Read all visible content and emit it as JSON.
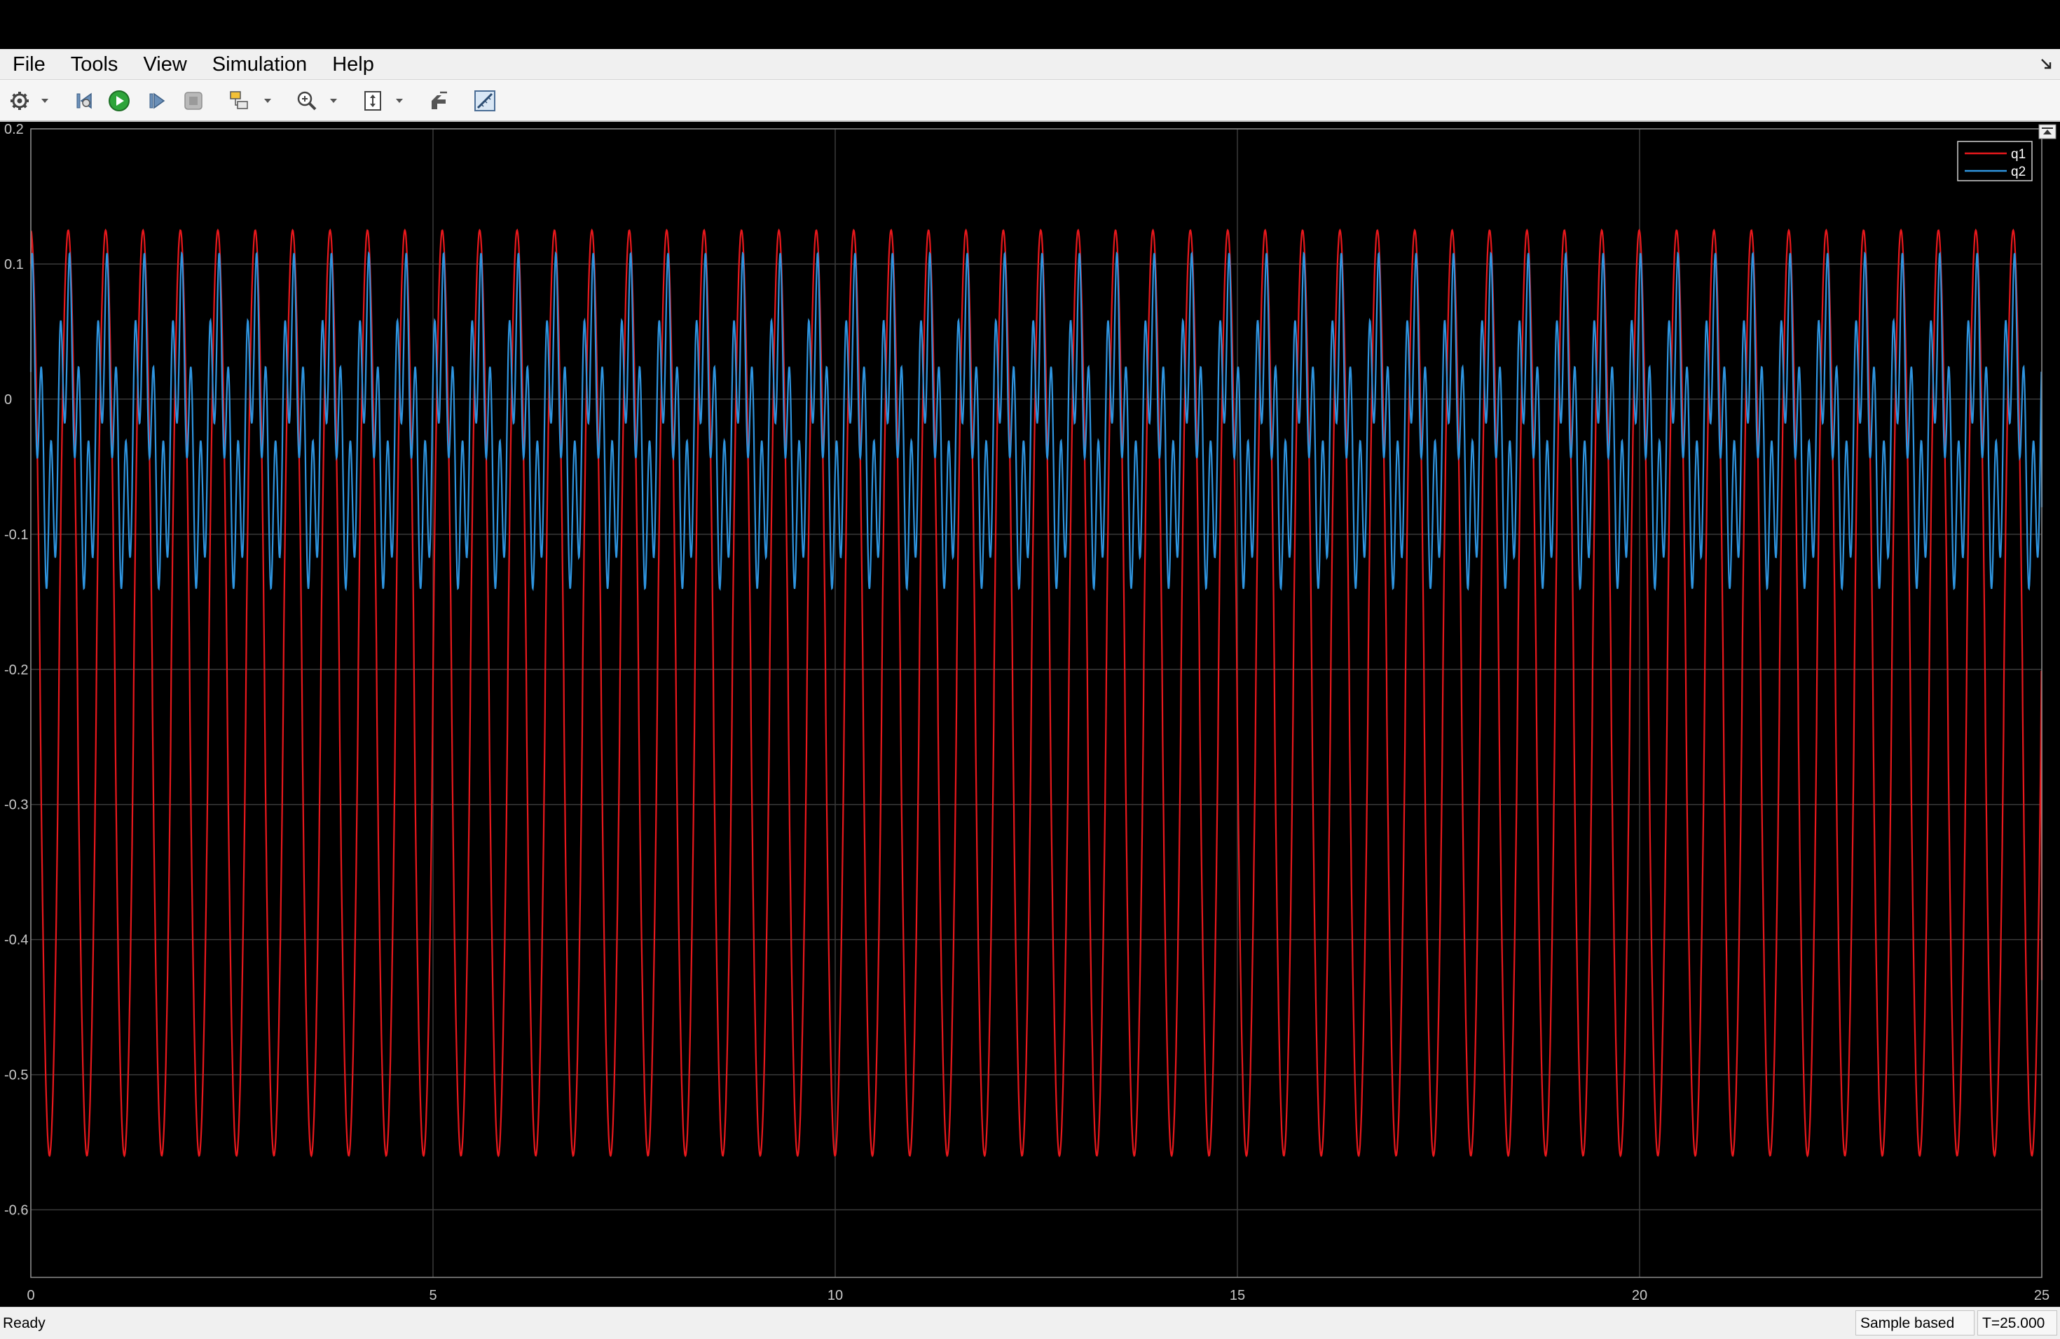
{
  "menu": {
    "items": [
      {
        "label": "File"
      },
      {
        "label": "Tools"
      },
      {
        "label": "View"
      },
      {
        "label": "Simulation"
      },
      {
        "label": "Help"
      }
    ]
  },
  "toolbar": {
    "icons": [
      "settings-gear-icon",
      "step-back-icon",
      "run-icon",
      "step-forward-icon",
      "stop-icon",
      "highlight-block-icon",
      "zoom-icon",
      "autoscale-icon",
      "signal-selector-icon",
      "measurements-icon"
    ]
  },
  "status": {
    "ready": "Ready",
    "mode": "Sample based",
    "time": "T=25.000"
  },
  "chart_data": {
    "type": "line",
    "title": "",
    "xlabel": "",
    "ylabel": "",
    "xlim": [
      0,
      25
    ],
    "ylim": [
      -0.65,
      0.2
    ],
    "xticks": [
      0,
      5,
      10,
      15,
      20,
      25
    ],
    "yticks": [
      0.2,
      0.1,
      0,
      -0.1,
      -0.2,
      -0.3,
      -0.4,
      -0.5,
      -0.6
    ],
    "grid": true,
    "background": "#000000",
    "legend_position": "top-right",
    "series": [
      {
        "name": "q1",
        "color": "#e8181c",
        "model": "oscillation",
        "period": 0.465,
        "max": 0.125,
        "min": -0.56,
        "start_value": 0.1,
        "end_value": -0.43
      },
      {
        "name": "q2",
        "color": "#2f95e0",
        "model": "oscillation",
        "period": 0.465,
        "max": 0.11,
        "min": -0.15,
        "start_value": 0.02,
        "end_value": -0.08
      }
    ]
  }
}
